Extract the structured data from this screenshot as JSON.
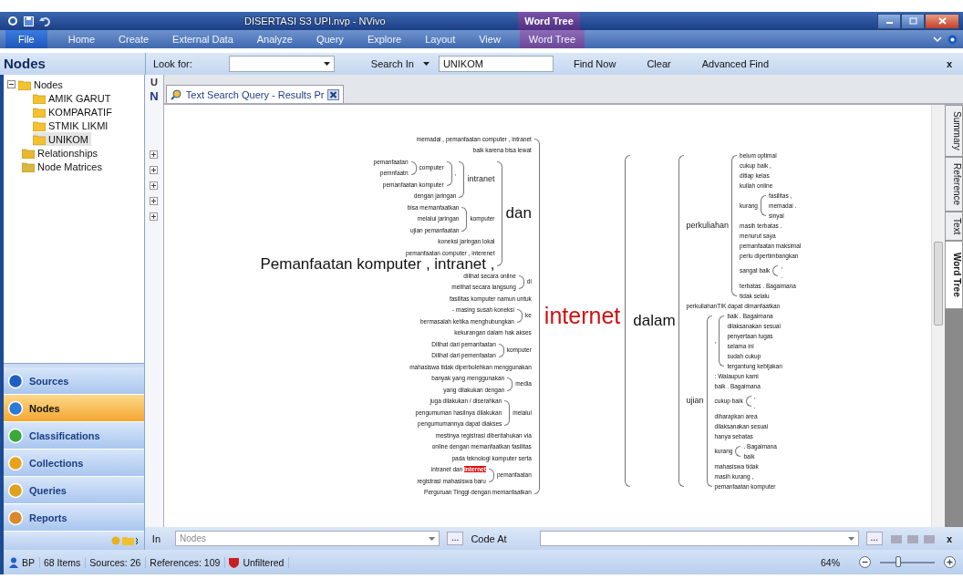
{
  "window": {
    "title": "DISERTASI S3 UPI.nvp - NVivo",
    "context_tab": "Word Tree"
  },
  "ribbon_tabs": [
    {
      "label": "File",
      "kind": "file"
    },
    {
      "label": "Home",
      "kind": "normal"
    },
    {
      "label": "Create",
      "kind": "normal"
    },
    {
      "label": "External Data",
      "kind": "normal"
    },
    {
      "label": "Analyze",
      "kind": "normal"
    },
    {
      "label": "Query",
      "kind": "normal"
    },
    {
      "label": "Explore",
      "kind": "normal"
    },
    {
      "label": "Layout",
      "kind": "normal"
    },
    {
      "label": "View",
      "kind": "normal"
    },
    {
      "label": "Word Tree",
      "kind": "context"
    }
  ],
  "find_bar": {
    "look_for_label": "Look for:",
    "search_in_label": "Search In",
    "search_in_value": "UNIKOM",
    "buttons": [
      "Find Now",
      "Clear",
      "Advanced Find"
    ],
    "close": "x"
  },
  "navigation": {
    "title": "Nodes",
    "tree": [
      {
        "label": "Nodes",
        "kind": "folder",
        "expanded": true,
        "selected": false,
        "children": [
          {
            "label": "AMIK GARUT",
            "kind": "folder",
            "selected": false
          },
          {
            "label": "KOMPARATIF",
            "kind": "folder",
            "selected": false
          },
          {
            "label": "STMIK LIKMI",
            "kind": "folder",
            "selected": false
          },
          {
            "label": "UNIKOM",
            "kind": "folder",
            "selected": true
          }
        ]
      },
      {
        "label": "Relationships",
        "kind": "relationships",
        "selected": false
      },
      {
        "label": "Node Matrices",
        "kind": "matrices",
        "selected": false
      }
    ],
    "buttons": [
      {
        "label": "Sources",
        "kind": "sources",
        "selected": false
      },
      {
        "label": "Nodes",
        "kind": "nodes",
        "selected": true
      },
      {
        "label": "Classifications",
        "kind": "classifications",
        "selected": false
      },
      {
        "label": "Collections",
        "kind": "collections",
        "selected": false
      },
      {
        "label": "Queries",
        "kind": "queries",
        "selected": false
      },
      {
        "label": "Reports",
        "kind": "reports",
        "selected": false
      }
    ]
  },
  "list_pane": {
    "column_1": "U",
    "column_2": "N"
  },
  "document_tab": {
    "label": "Text Search Query - Results Pr"
  },
  "word_tree": {
    "root": "internet",
    "left": [
      {
        "text": "memadai , pemanfaatan computer , intranet"
      },
      {
        "text": "baik karena bisa lewat"
      },
      {
        "text": "dan",
        "kind": "large",
        "children": [
          {
            "text": "intranet",
            "kind": "medium",
            "children": [
              {
                "text": ",",
                "children": [
                  {
                    "text": "computer",
                    "children": [
                      {
                        "text": "pemanfaatan"
                      },
                      {
                        "text": "pemnfaatn"
                      }
                    ]
                  },
                  {
                    "text": "pemanfaatan komputer"
                  }
                ]
              },
              {
                "text": "dengan jaringan"
              }
            ]
          },
          {
            "text": "komputer",
            "children": [
              {
                "text": "bisa memanfaatkan"
              },
              {
                "text": "melalui jaringan"
              },
              {
                "text": "ujian pemanfaatan"
              }
            ]
          },
          {
            "text": "koneksi jaringan lokal"
          },
          {
            "text": "pemanfaatan computer , interenet"
          },
          {
            "text": "Pemanfaatan komputer , intranet ,",
            "kind": "large"
          }
        ]
      },
      {
        "text": "di",
        "children": [
          {
            "text": "dilihat secara online"
          },
          {
            "text": "melihat secara langsung"
          }
        ]
      },
      {
        "text": "fasilitas komputer namun untuk"
      },
      {
        "text": "ke",
        "children": [
          {
            "text": "- masing susah koneksi"
          },
          {
            "text": "bermasalah ketika menghubungkan"
          }
        ]
      },
      {
        "text": "kekurangan dalam hak akses"
      },
      {
        "text": "komputer",
        "children": [
          {
            "text": "Dilihat dari pemanfaatan"
          },
          {
            "text": "Dilihat dari pemenfaatan"
          }
        ]
      },
      {
        "text": "mahasiswa tidak diperbolehkan menggunakan"
      },
      {
        "text": "media",
        "children": [
          {
            "text": "banyak yang menggunakan"
          },
          {
            "text": "yang dilakukan dengan"
          }
        ]
      },
      {
        "text": "melalui",
        "children": [
          {
            "text": "juga dilakukan / diserahkan"
          },
          {
            "text": "pengumuman hasilnya dilakukan"
          },
          {
            "text": "pengumumannya dapat diakses"
          }
        ]
      },
      {
        "text": "mestinya registrasi diberitahukan via"
      },
      {
        "text": "online dengan memanfaatkan fasilitas"
      },
      {
        "text": "pada teknologi komputer serta"
      },
      {
        "text": "pemanfaatan",
        "children": [
          {
            "text": "intranet dan",
            "match": "internet"
          },
          {
            "text": "registrasi mahasiswa baru"
          }
        ]
      },
      {
        "text": "Perguruan Tinggi dengan memanfaatkan"
      }
    ],
    "right": [
      {
        "text": "dalam",
        "kind": "large",
        "children": [
          {
            "text": "perkuliahan",
            "kind": "medium",
            "children": [
              {
                "text": "belum optimal"
              },
              {
                "text": "cukup baik ,"
              },
              {
                "text": "ditiap kelas"
              },
              {
                "text": "kuliah online"
              },
              {
                "text": "kurang",
                "children": [
                  {
                    "text": "fasilitas ,"
                  },
                  {
                    "text": "memadai ."
                  },
                  {
                    "text": "sinyal"
                  }
                ]
              },
              {
                "text": "masih terbatas ."
              },
              {
                "text": "menurut saya"
              },
              {
                "text": "pemanfaatan maksimal"
              },
              {
                "text": "perlu dipertimbangkan"
              },
              {
                "text": "sangat baik",
                "children": [
                  {
                    "text": ","
                  },
                  {
                    "text": "."
                  }
                ]
              },
              {
                "text": "terbatas . Bagaimana"
              },
              {
                "text": "tidak selalu"
              }
            ]
          },
          {
            "text": "perkuliahanTIK dapat dimanfaatkan"
          },
          {
            "text": "ujian",
            "kind": "medium",
            "children": [
              {
                "text": ",",
                "children": [
                  {
                    "text": "baik . Bagaimana"
                  },
                  {
                    "text": "dilaksanakan sesuai"
                  },
                  {
                    "text": "penyertaan tugas"
                  },
                  {
                    "text": "selama ini"
                  },
                  {
                    "text": "sudah cukup"
                  },
                  {
                    "text": "tergantung kebijakan"
                  }
                ]
              },
              {
                "text": ": Walaupun kami"
              },
              {
                "text": "baik . Bagaimana"
              },
              {
                "text": "cukup baik",
                "children": [
                  {
                    "text": ","
                  },
                  {
                    "text": "."
                  }
                ]
              },
              {
                "text": "diharapkan area"
              },
              {
                "text": "dilaksanakan sesuai"
              },
              {
                "text": "hanya sebatas"
              },
              {
                "text": "kurang",
                "children": [
                  {
                    "text": ". Bagaimana"
                  },
                  {
                    "text": "baik"
                  }
                ]
              },
              {
                "text": "mahasiswa tidak"
              },
              {
                "text": "masih kurang ,"
              },
              {
                "text": "pemanfaatan komputer"
              }
            ]
          }
        ]
      }
    ]
  },
  "side_tabs": [
    {
      "label": "Summary",
      "selected": false
    },
    {
      "label": "Reference",
      "selected": false
    },
    {
      "label": "Text",
      "selected": false
    },
    {
      "label": "Word Tree",
      "selected": true
    }
  ],
  "code_bar": {
    "in_label": "In",
    "in_placeholder": "Nodes",
    "browse": "...",
    "code_at_label": "Code At",
    "browse_2": "...",
    "close": "x"
  },
  "status_bar": {
    "user": "BP",
    "items": "68 Items",
    "sources": "Sources: 26",
    "references": "References: 109",
    "filter": "Unfiltered",
    "zoom": "64%",
    "zoom_slider": {
      "level": 0.33
    }
  }
}
